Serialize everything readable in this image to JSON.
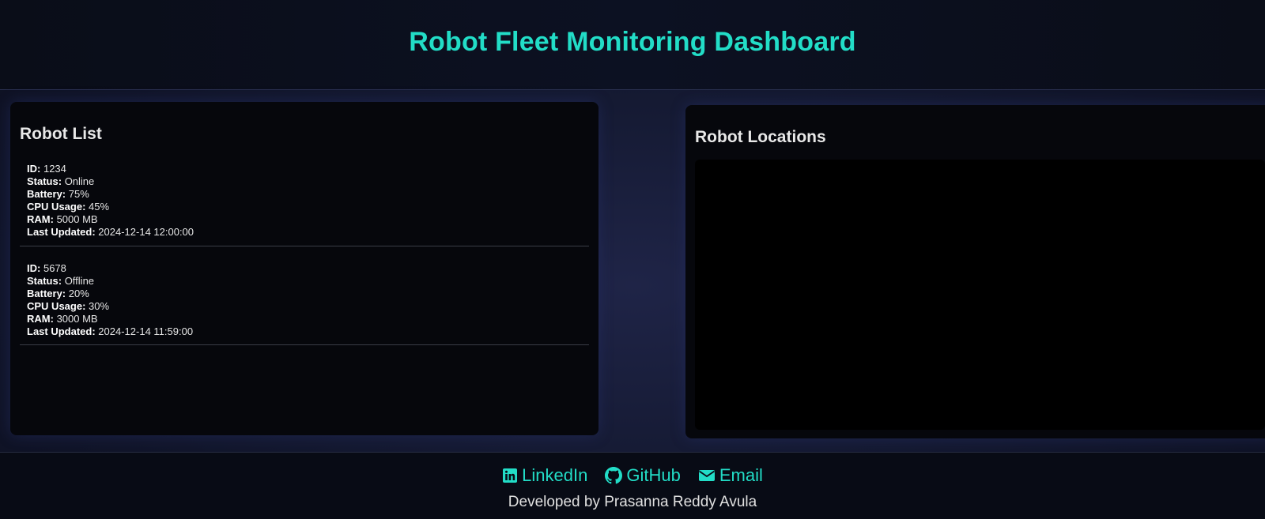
{
  "header": {
    "title": "Robot Fleet Monitoring Dashboard"
  },
  "robot_list": {
    "heading": "Robot List",
    "labels": {
      "id": "ID:",
      "status": "Status:",
      "battery": "Battery:",
      "cpu": "CPU Usage:",
      "ram": "RAM:",
      "updated": "Last Updated:"
    },
    "robots": [
      {
        "id": "1234",
        "status": "Online",
        "battery": "75%",
        "cpu": "45%",
        "ram": "5000 MB",
        "updated": "2024-12-14 12:00:00"
      },
      {
        "id": "5678",
        "status": "Offline",
        "battery": "20%",
        "cpu": "30%",
        "ram": "3000 MB",
        "updated": "2024-12-14 11:59:00"
      }
    ]
  },
  "map": {
    "heading": "Robot Locations"
  },
  "footer": {
    "links": [
      {
        "label": "LinkedIn",
        "icon": "linkedin-icon"
      },
      {
        "label": "GitHub",
        "icon": "github-icon"
      },
      {
        "label": "Email",
        "icon": "envelope-icon"
      }
    ],
    "credit": "Developed by Prasanna Reddy Avula"
  },
  "colors": {
    "accent": "#22ddc7",
    "background": "#151a33",
    "panel": "#06070c"
  }
}
